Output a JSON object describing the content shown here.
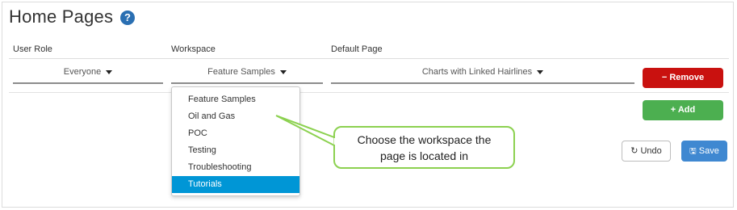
{
  "page": {
    "title": "Home Pages",
    "help_glyph": "?"
  },
  "table": {
    "headers": {
      "user_role": "User Role",
      "workspace": "Workspace",
      "default_page": "Default Page"
    },
    "row": {
      "user_role": "Everyone",
      "workspace": "Feature Samples",
      "default_page": "Charts with Linked Hairlines"
    }
  },
  "buttons": {
    "remove": "Remove",
    "remove_glyph": "−",
    "add": "Add",
    "add_glyph": "+",
    "undo": "Undo",
    "undo_glyph": "↻",
    "save": "Save",
    "save_glyph": "🖫"
  },
  "workspace_dropdown": {
    "options": [
      "Feature Samples",
      "Oil and Gas",
      "POC",
      "Testing",
      "Troubleshooting",
      "Tutorials"
    ],
    "highlighted": "Tutorials"
  },
  "callout": {
    "line1": "Choose the workspace the",
    "line2": "page is located in"
  },
  "colors": {
    "remove": "#c9110f",
    "add": "#4caf50",
    "save": "#3f88d1",
    "highlight": "#0096d6",
    "callout_border": "#8cd150",
    "help_icon": "#2a6fb2"
  }
}
